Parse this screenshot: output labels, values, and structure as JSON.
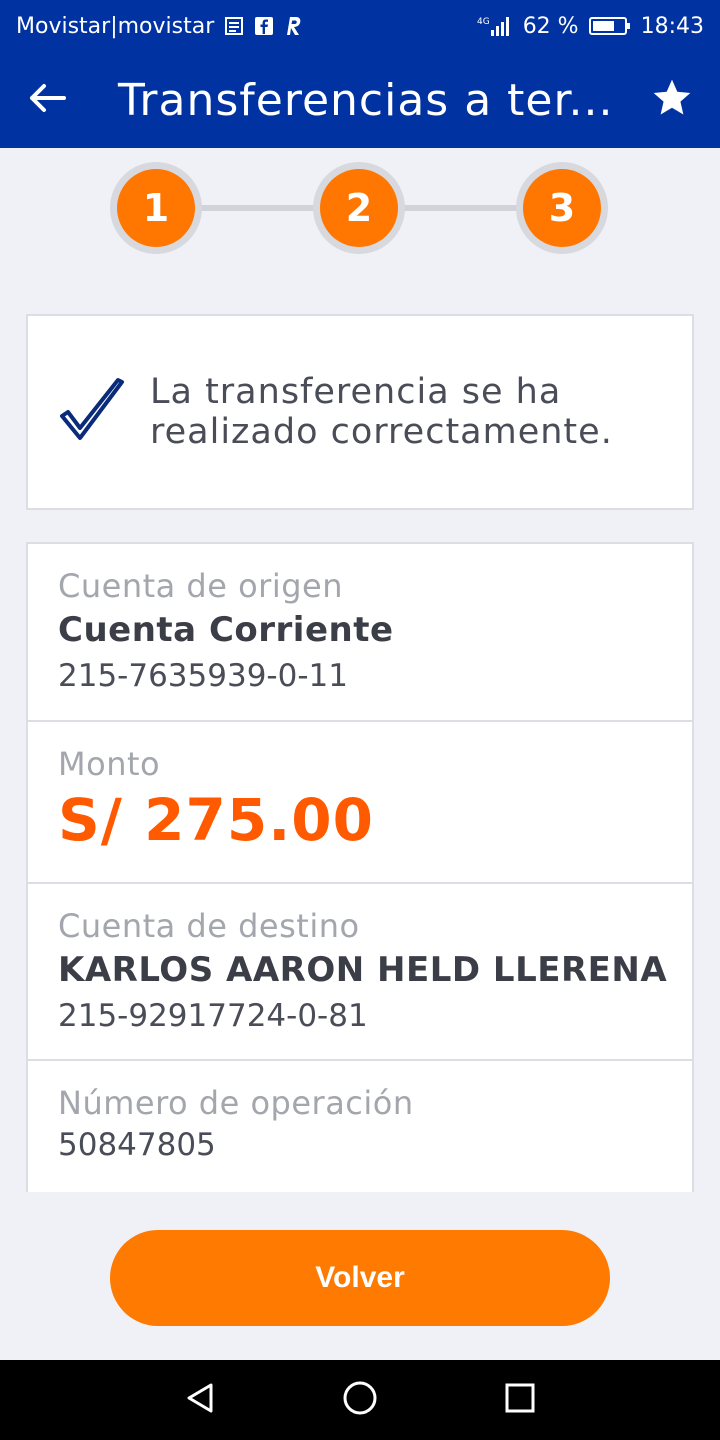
{
  "status_bar": {
    "carrier": "Movistar|movistar",
    "network": "4G",
    "battery": "62 %",
    "time": "18:43",
    "icons": [
      "news-icon",
      "facebook-icon",
      "app-r-icon",
      "signal-icon",
      "battery-icon"
    ]
  },
  "app_bar": {
    "title": "Transferencias a ter...",
    "back_icon": "arrow-left-icon",
    "favorite_icon": "star-icon"
  },
  "stepper": {
    "steps": [
      "1",
      "2",
      "3"
    ]
  },
  "success": {
    "icon": "check-icon",
    "line1": "La transferencia se ha",
    "line2": "realizado correctamente."
  },
  "details": {
    "origin": {
      "label": "Cuenta de origen",
      "name": "Cuenta Corriente",
      "number": "215-7635939-0-11"
    },
    "amount": {
      "label": "Monto",
      "value": "S/ 275.00"
    },
    "destination": {
      "label": "Cuenta de destino",
      "name": "KARLOS AARON HELD LLERENA",
      "number": "215-92917724-0-81"
    },
    "operation": {
      "label": "Número de operación",
      "value": "50847805"
    }
  },
  "actions": {
    "back_label": "Volver"
  },
  "nav": {
    "icons": [
      "nav-back-icon",
      "nav-home-icon",
      "nav-recents-icon"
    ]
  },
  "colors": {
    "primary": "#0033a1",
    "accent": "#ff7600",
    "amount": "#ff5a00"
  }
}
